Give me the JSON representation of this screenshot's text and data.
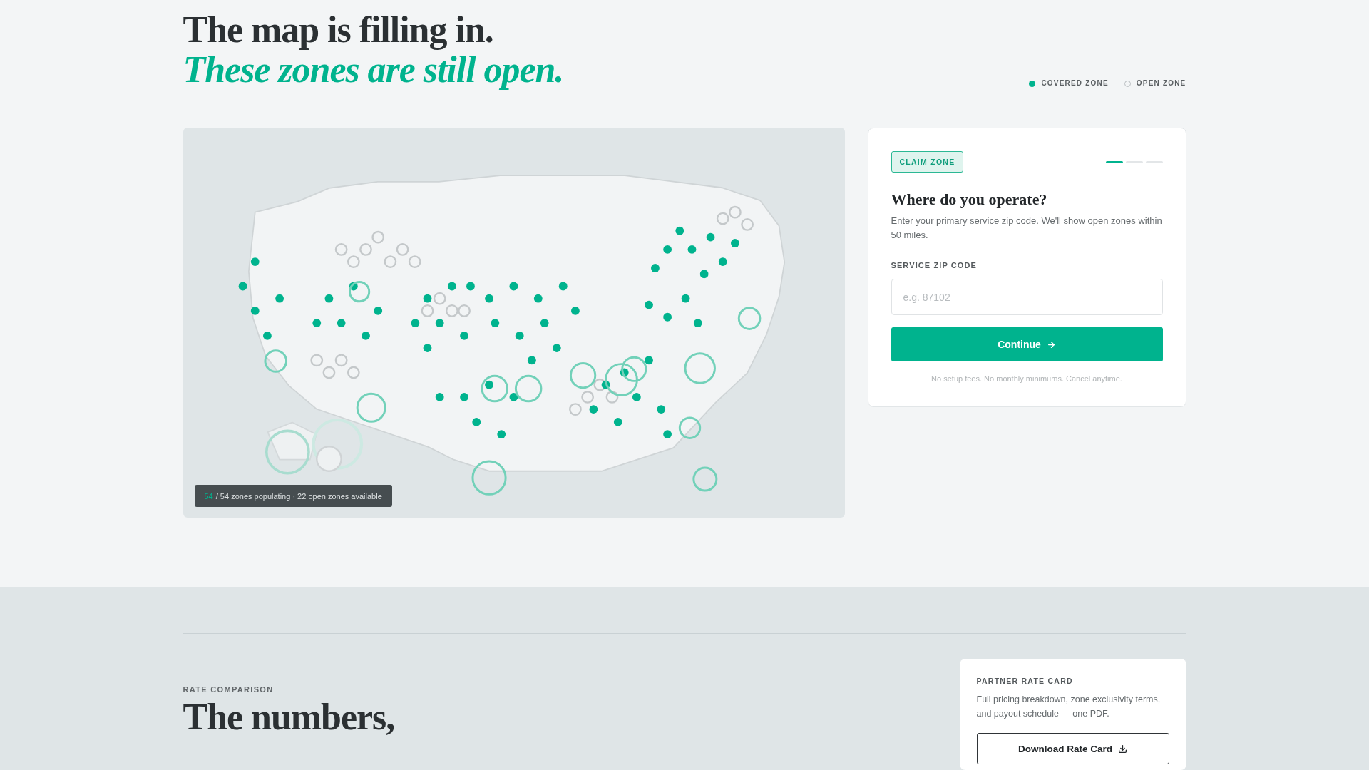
{
  "header": {
    "title": "The map is filling in.",
    "subtitle": "These zones are still open."
  },
  "legend": [
    {
      "kind": "covered",
      "label": "COVERED ZONE"
    },
    {
      "kind": "open",
      "label": "OPEN ZONE"
    }
  ],
  "map": {
    "status": {
      "count": "54",
      "text": "/ 54 zones populating · 22 open zones available"
    }
  },
  "claim_card": {
    "badge": "CLAIM ZONE",
    "steps": [
      {
        "active": true
      },
      {
        "active": false
      },
      {
        "active": false
      }
    ],
    "title": "Where do you operate?",
    "description": "Enter your primary service zip code. We'll show open zones within 50 miles.",
    "field": {
      "label": "SERVICE ZIP CODE",
      "placeholder": "e.g. 87102"
    },
    "button": "Continue",
    "note": "No setup fees. No monthly minimums. Cancel anytime."
  },
  "rate_section": {
    "eyebrow": "RATE COMPARISON",
    "title": "The numbers,",
    "card": {
      "title": "PARTNER RATE CARD",
      "description": "Full pricing breakdown, zone exclusivity terms, and payout schedule — one PDF.",
      "button": "Download Rate Card"
    }
  }
}
